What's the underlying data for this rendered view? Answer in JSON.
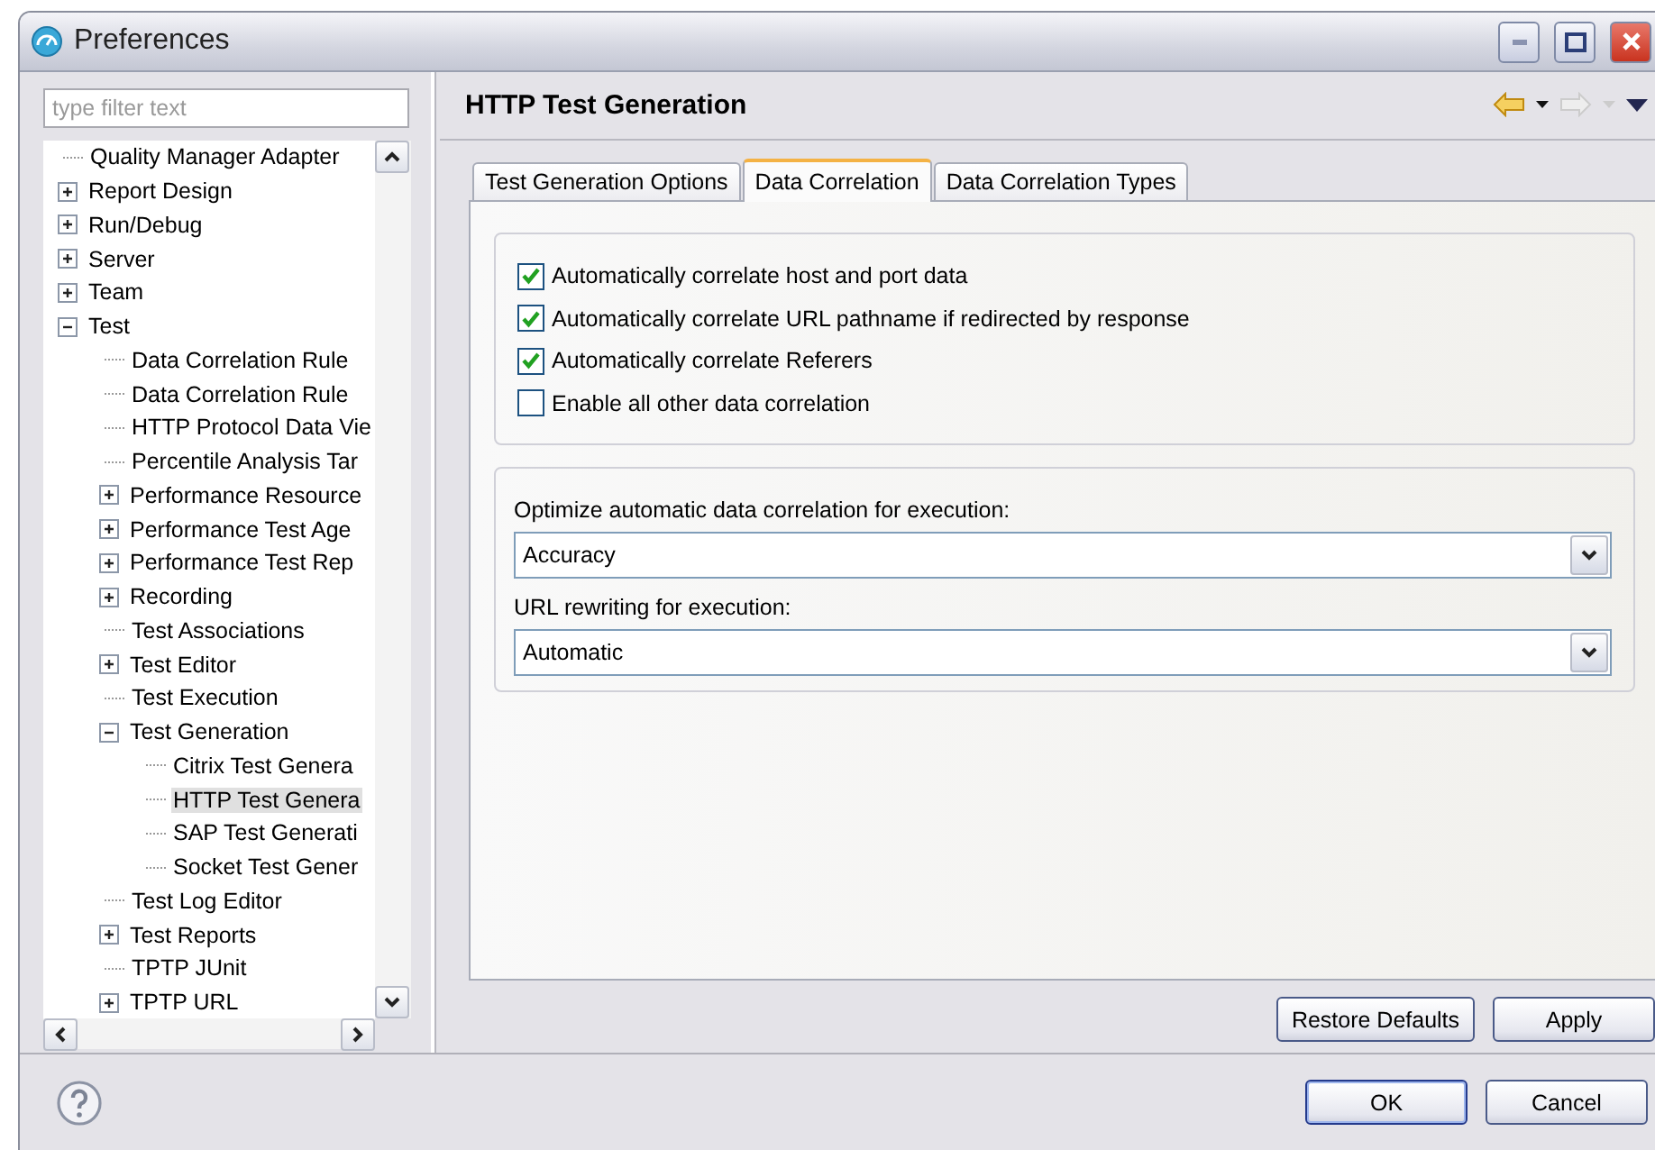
{
  "window": {
    "title": "Preferences"
  },
  "filter": {
    "placeholder": "type filter text"
  },
  "tree": [
    {
      "label": "Quality Manager Adapter",
      "selected": false
    },
    {
      "label": "Report Design",
      "expanded": false,
      "selected": false
    },
    {
      "label": "Run/Debug",
      "expanded": false,
      "selected": false
    },
    {
      "label": "Server",
      "expanded": false,
      "selected": false
    },
    {
      "label": "Team",
      "expanded": false,
      "selected": false
    },
    {
      "label": "Test",
      "expanded": true,
      "selected": false,
      "children": [
        {
          "label": "Data Correlation Rule",
          "selected": false
        },
        {
          "label": "Data Correlation Rule",
          "selected": false
        },
        {
          "label": "HTTP Protocol Data Vie",
          "selected": false
        },
        {
          "label": "Percentile Analysis Tar",
          "selected": false
        },
        {
          "label": "Performance Resource",
          "expanded": false,
          "selected": false
        },
        {
          "label": "Performance Test Age",
          "expanded": false,
          "selected": false
        },
        {
          "label": "Performance Test Rep",
          "expanded": false,
          "selected": false
        },
        {
          "label": "Recording",
          "expanded": false,
          "selected": false
        },
        {
          "label": "Test Associations",
          "selected": false
        },
        {
          "label": "Test Editor",
          "expanded": false,
          "selected": false
        },
        {
          "label": "Test Execution",
          "selected": false
        },
        {
          "label": "Test Generation",
          "expanded": true,
          "selected": false,
          "children": [
            {
              "label": "Citrix Test Genera",
              "selected": false
            },
            {
              "label": "HTTP Test Genera",
              "selected": true
            },
            {
              "label": "SAP Test Generati",
              "selected": false
            },
            {
              "label": "Socket Test Gener",
              "selected": false
            }
          ]
        },
        {
          "label": "Test Log Editor",
          "selected": false
        },
        {
          "label": "Test Reports",
          "expanded": false,
          "selected": false
        },
        {
          "label": "TPTP JUnit",
          "selected": false
        },
        {
          "label": "TPTP URL",
          "expanded": false,
          "selected": false
        }
      ]
    }
  ],
  "page": {
    "title": "HTTP Test Generation"
  },
  "tabs": [
    {
      "label": "Test Generation Options",
      "selected": false
    },
    {
      "label": "Data Correlation",
      "selected": true
    },
    {
      "label": "Data Correlation Types",
      "selected": false
    }
  ],
  "checkboxes": [
    {
      "label": "Automatically correlate host and port data",
      "checked": true
    },
    {
      "label": "Automatically correlate URL pathname if redirected by response",
      "checked": true
    },
    {
      "label": "Automatically correlate Referers",
      "checked": true
    },
    {
      "label": "Enable all other data correlation",
      "checked": false
    }
  ],
  "selects": [
    {
      "label": "Optimize automatic data correlation for execution:",
      "value": "Accuracy"
    },
    {
      "label": "URL rewriting for execution:",
      "value": "Automatic"
    }
  ],
  "page_buttons": [
    "Restore Defaults",
    "Apply"
  ],
  "dialog_buttons": [
    {
      "label": "OK",
      "default": true
    },
    {
      "label": "Cancel",
      "default": false
    }
  ]
}
